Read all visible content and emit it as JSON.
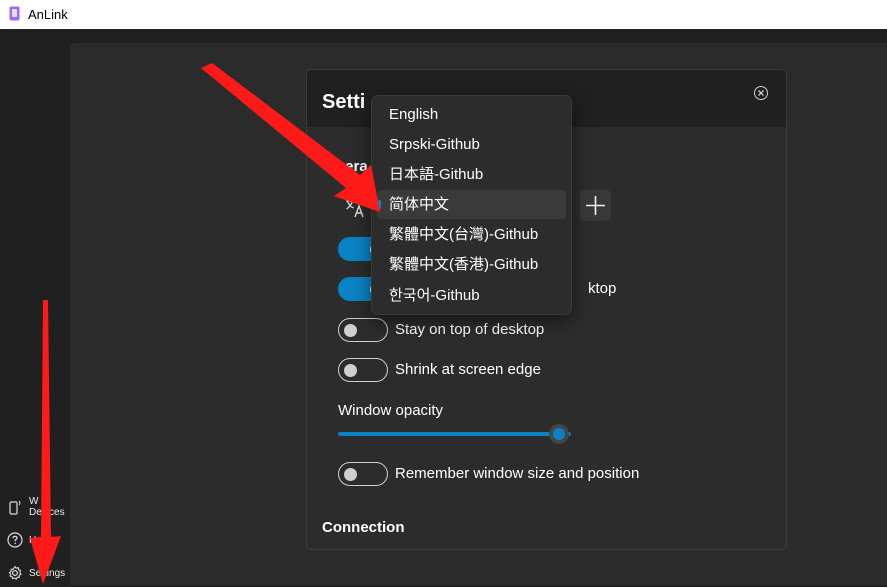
{
  "window": {
    "title": "AnLink"
  },
  "nav": {
    "items": [
      {
        "label": "W\nDevices",
        "icon": "phone-wireless-icon"
      },
      {
        "label": "H",
        "icon": "help-icon"
      },
      {
        "label": "Settings",
        "icon": "gear-icon"
      }
    ]
  },
  "dialog": {
    "title": "Setti",
    "general_header": "nera",
    "connection_header": "Connection",
    "toggles": [
      {
        "label": "",
        "state": "on"
      },
      {
        "label": "ktop",
        "state": "on"
      },
      {
        "label": "Stay on top of desktop",
        "state": "off"
      },
      {
        "label": "Shrink at screen edge",
        "state": "off"
      },
      {
        "label": "Remember window size and position",
        "state": "off"
      }
    ],
    "opacity": {
      "label": "Window opacity",
      "value": 0.95
    }
  },
  "language_menu": {
    "options": [
      "English",
      "Srpski-Github",
      "日本語-Github",
      "简体中文",
      "繁體中文(台灣)-Github",
      "繁體中文(香港)-Github",
      "한국어-Github"
    ],
    "selected": "简体中文"
  },
  "colors": {
    "accent": "#0a83c6",
    "annotation": "#ff1a1a"
  }
}
